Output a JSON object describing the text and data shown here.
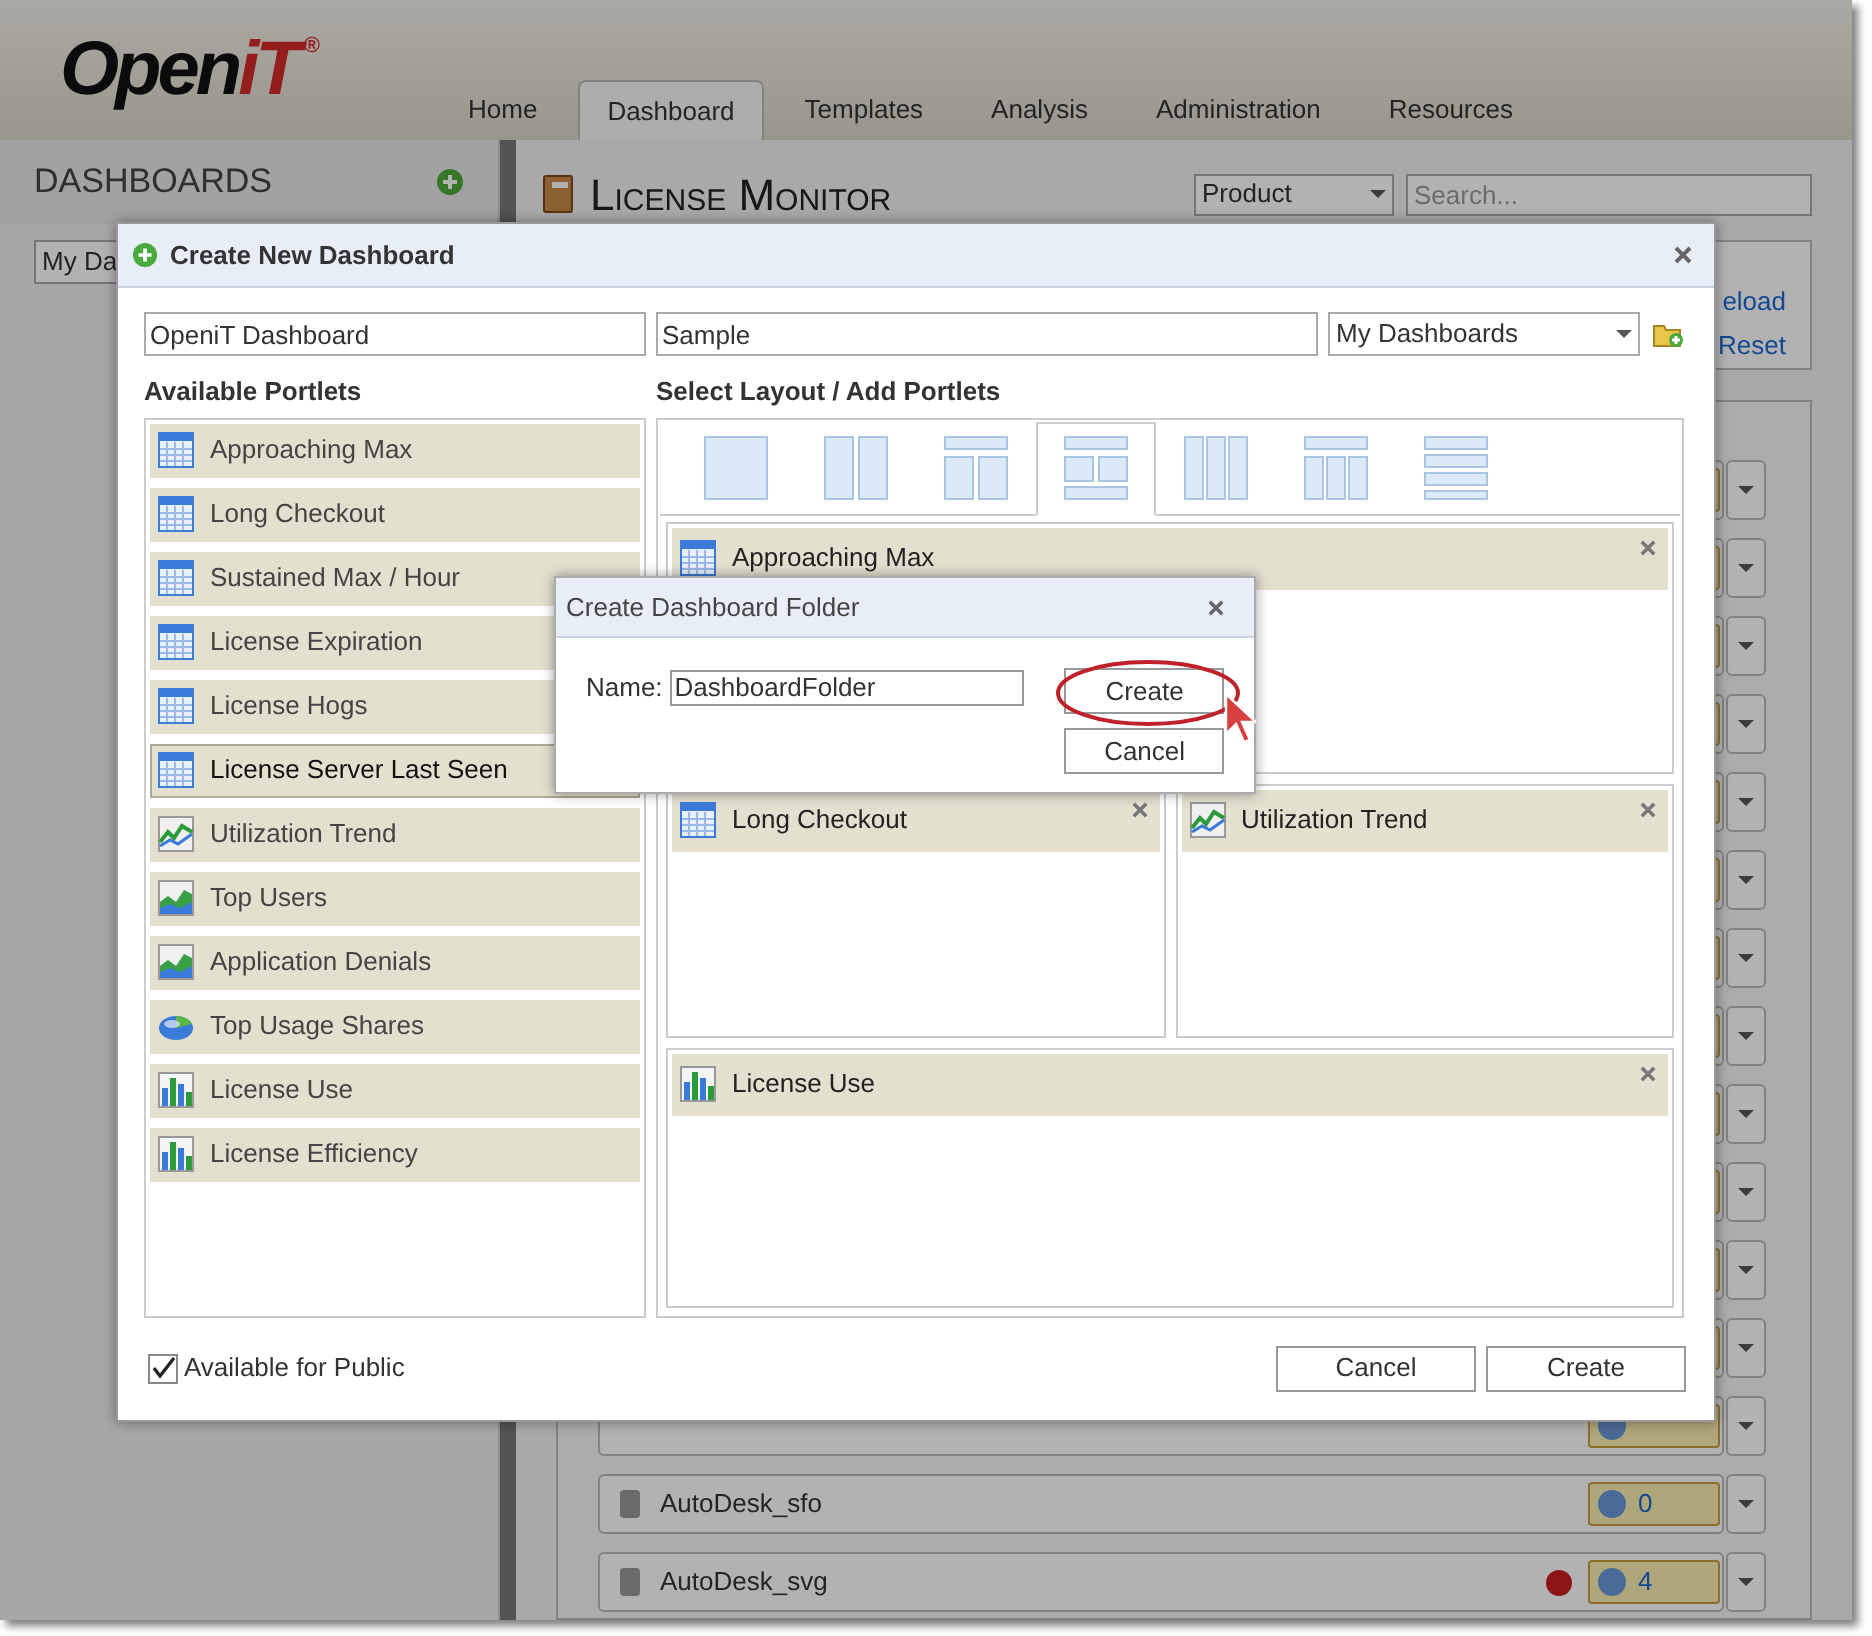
{
  "logo": {
    "main": "Open",
    "accent": "iT",
    "mark": "®"
  },
  "nav_tabs": [
    {
      "label": "Home",
      "selected": false
    },
    {
      "label": "Dashboard",
      "selected": true
    },
    {
      "label": "Templates",
      "selected": false
    },
    {
      "label": "Analysis",
      "selected": false
    },
    {
      "label": "Administration",
      "selected": false
    },
    {
      "label": "Resources",
      "selected": false
    }
  ],
  "sidebar": {
    "title": "DASHBOARDS",
    "dropdown_value": "My Da"
  },
  "page": {
    "title": "License Monitor",
    "filter": "Product",
    "search_placeholder": "Search...",
    "links": [
      "eload",
      "Reset"
    ]
  },
  "servers": [
    {
      "name": "AutoDesk_sfo",
      "count": "0",
      "alert": false
    },
    {
      "name": "AutoDesk_svg",
      "count": "4",
      "alert": true
    }
  ],
  "dialog": {
    "title": "Create New Dashboard",
    "name_value": "OpeniT Dashboard",
    "description_value": "Sample",
    "folder_value": "My Dashboards",
    "available_label": "Available Portlets",
    "layout_label": "Select Layout / Add Portlets",
    "portlets": [
      {
        "label": "Approaching Max",
        "kind": "table",
        "highlighted": false
      },
      {
        "label": "Long Checkout",
        "kind": "table",
        "highlighted": false
      },
      {
        "label": "Sustained Max / Hour",
        "kind": "table",
        "highlighted": false
      },
      {
        "label": "License Expiration",
        "kind": "table",
        "highlighted": false
      },
      {
        "label": "License Hogs",
        "kind": "table",
        "highlighted": false
      },
      {
        "label": "License Server Last Seen",
        "kind": "table",
        "highlighted": true
      },
      {
        "label": "Utilization Trend",
        "kind": "line",
        "highlighted": false
      },
      {
        "label": "Top Users",
        "kind": "area",
        "highlighted": false
      },
      {
        "label": "Application Denials",
        "kind": "area",
        "highlighted": false
      },
      {
        "label": "Top Usage Shares",
        "kind": "pie",
        "highlighted": false
      },
      {
        "label": "License Use",
        "kind": "bar",
        "highlighted": false
      },
      {
        "label": "License Efficiency",
        "kind": "bar",
        "highlighted": false
      }
    ],
    "layouts": [
      {
        "kind": "one",
        "selected": false
      },
      {
        "kind": "two",
        "selected": false
      },
      {
        "kind": "top-two",
        "selected": false
      },
      {
        "kind": "top-grid",
        "selected": true
      },
      {
        "kind": "three",
        "selected": false
      },
      {
        "kind": "top-three",
        "selected": false
      },
      {
        "kind": "rows",
        "selected": false
      }
    ],
    "slots": [
      [
        {
          "label": "Approaching Max",
          "kind": "table"
        }
      ],
      [
        {
          "label": "Long Checkout",
          "kind": "table"
        },
        {
          "label": "Utilization Trend",
          "kind": "line"
        }
      ],
      [
        {
          "label": "License Use",
          "kind": "bar"
        }
      ]
    ],
    "public": {
      "label": "Available for Public",
      "checked": true
    },
    "buttons": [
      "Cancel",
      "Create"
    ]
  },
  "folder_dialog": {
    "title": "Create Dashboard Folder",
    "name_label": "Name:",
    "name_value": "DashboardFolder",
    "buttons": [
      "Create",
      "Cancel"
    ]
  }
}
